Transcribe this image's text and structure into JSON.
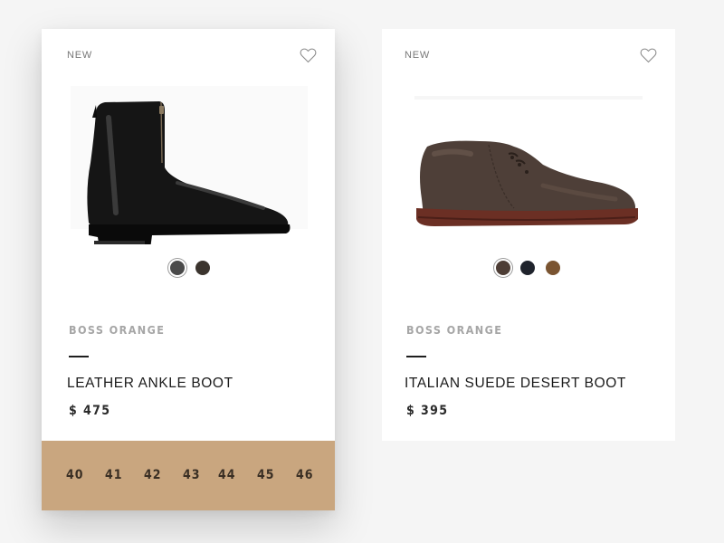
{
  "products": [
    {
      "badge": "NEW",
      "brand": "BOSS ORANGE",
      "name": "LEATHER ANKLE BOOT",
      "price": "$ 475",
      "image_icon": "leather-ankle-boot-image",
      "swatches": [
        {
          "color": "#4a4a4a",
          "selected": true
        },
        {
          "color": "#3b342e",
          "selected": false
        }
      ],
      "sizes": [
        "40",
        "41",
        "42",
        "43",
        "44",
        "45",
        "46"
      ]
    },
    {
      "badge": "NEW",
      "brand": "BOSS ORANGE",
      "name": "ITALIAN SUEDE DESERT BOOT",
      "price": "$ 395",
      "image_icon": "suede-desert-boot-image",
      "swatches": [
        {
          "color": "#4d3d35",
          "selected": true
        },
        {
          "color": "#1f232c",
          "selected": false
        },
        {
          "color": "#7a5431",
          "selected": false
        }
      ]
    }
  ],
  "colors": {
    "background": "#f5f5f5",
    "card": "#ffffff",
    "size_bar": "#c9a67f",
    "text_dark": "#1b1b1b",
    "text_muted": "#a6a6a6"
  }
}
